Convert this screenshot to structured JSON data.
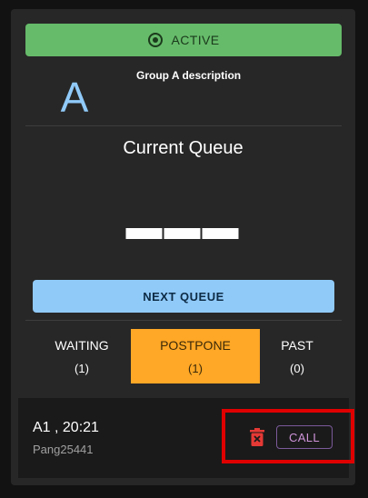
{
  "status": {
    "label": "ACTIVE",
    "color": "#66bb6a"
  },
  "group": {
    "letter": "A",
    "description": "Group A description"
  },
  "queue": {
    "title": "Current Queue",
    "number": "▬▬▬"
  },
  "next_button": {
    "label": "NEXT QUEUE"
  },
  "tabs": [
    {
      "label": "WAITING",
      "count": "(1)"
    },
    {
      "label": "POSTPONE",
      "count": "(1)"
    },
    {
      "label": "PAST",
      "count": "(0)"
    }
  ],
  "entry": {
    "title": "A1 , 20:21",
    "subtitle": "Pang25441",
    "call_label": "CALL"
  },
  "colors": {
    "accent_blue": "#90caf9",
    "postpone_orange": "#ffa726",
    "highlight_red": "#e00000",
    "delete_red": "#e53935"
  }
}
